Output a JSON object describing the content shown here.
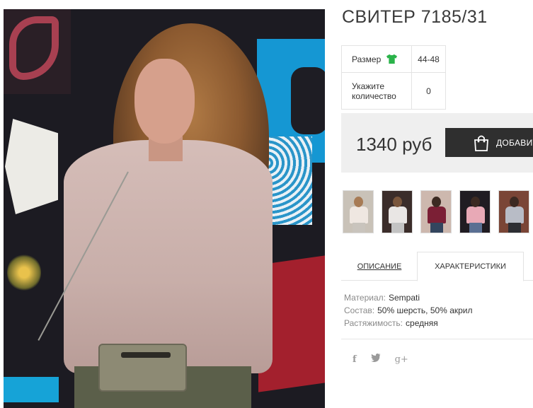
{
  "product": {
    "title": "СВИТЕР 7185/31",
    "options": {
      "size_label": "Размер",
      "size_value": "44-48",
      "qty_label": "Укажите количество",
      "qty_value": "0"
    },
    "price": "1340 руб",
    "add_button_label": "ДОБАВИТ",
    "thumbnails": [
      {
        "bg": "#c9c2b8",
        "head": "#a77b55",
        "body": "#efe7e1",
        "legs": "#c9c4bd"
      },
      {
        "bg": "#3b2d2a",
        "head": "#7a563c",
        "body": "#e9e6e4",
        "legs": "#c3c3c3"
      },
      {
        "bg": "#cdb8ae",
        "head": "#3c2a22",
        "body": "#7b1f35",
        "legs": "#33455e"
      },
      {
        "bg": "#201c22",
        "head": "#3c2a22",
        "body": "#e8a9b6",
        "legs": "#5a6f92"
      },
      {
        "bg": "#7a4536",
        "head": "#3c2a22",
        "body": "#b8bcc6",
        "legs": "#2d2e33"
      }
    ]
  },
  "tabs": {
    "description": "ОПИСАНИЕ",
    "characteristics": "ХАРАКТЕРИСТИКИ"
  },
  "specs": [
    {
      "key": "Материал:",
      "value": "Sempati"
    },
    {
      "key": "Состав:",
      "value": "50% шерсть, 50% акрил"
    },
    {
      "key": "Растяжимость:",
      "value": "средняя"
    }
  ],
  "social": {
    "facebook": "f",
    "twitter": "🐦",
    "googleplus": "g+"
  },
  "colors": {
    "size_icon": "#2ab34a",
    "button_bg": "#2f2f2f",
    "price_box_bg": "#efefef"
  }
}
